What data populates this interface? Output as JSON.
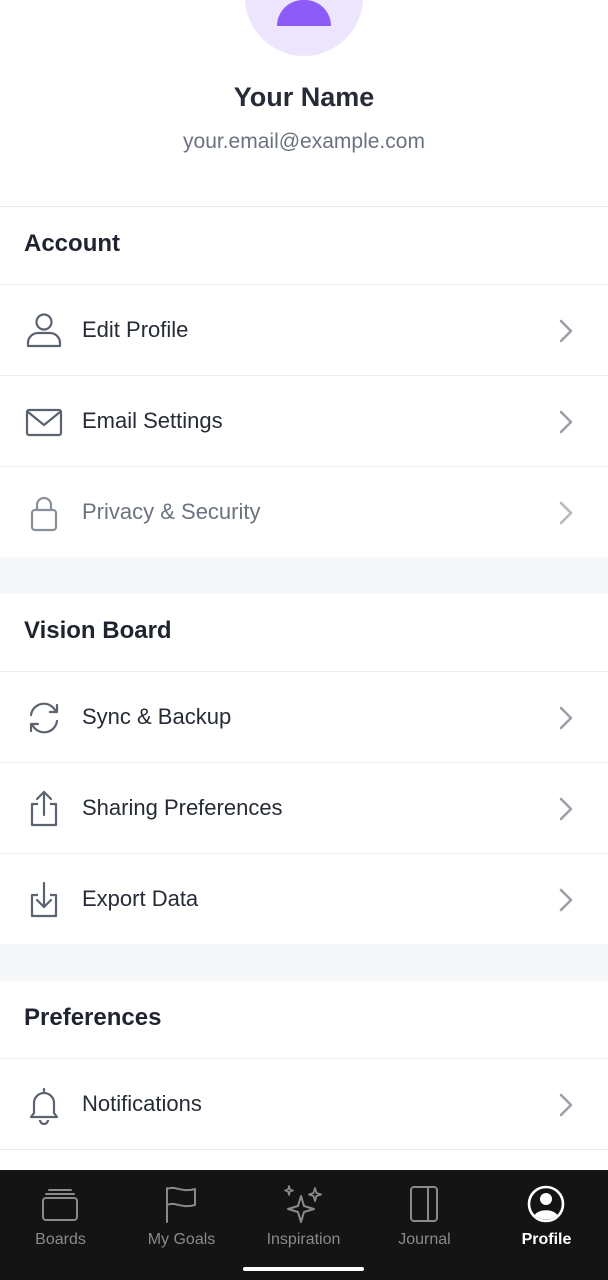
{
  "profile": {
    "name": "Your Name",
    "email": "your.email@example.com",
    "avatar_color": "#8b5cf6",
    "avatar_bg": "#ede4fd"
  },
  "sections": {
    "account": {
      "title": "Account",
      "items": [
        {
          "label": "Edit Profile",
          "icon": "user-icon"
        },
        {
          "label": "Email Settings",
          "icon": "envelope-icon"
        },
        {
          "label": "Privacy & Security",
          "icon": "lock-icon"
        }
      ]
    },
    "vision_board": {
      "title": "Vision Board",
      "items": [
        {
          "label": "Sync & Backup",
          "icon": "sync-icon"
        },
        {
          "label": "Sharing Preferences",
          "icon": "share-icon"
        },
        {
          "label": "Export Data",
          "icon": "download-icon"
        }
      ]
    },
    "preferences": {
      "title": "Preferences",
      "items": [
        {
          "label": "Notifications",
          "icon": "bell-icon"
        }
      ]
    }
  },
  "tabbar": {
    "tabs": [
      {
        "label": "Boards",
        "icon": "boards-icon",
        "active": false
      },
      {
        "label": "My Goals",
        "icon": "flag-icon",
        "active": false
      },
      {
        "label": "Inspiration",
        "icon": "sparkles-icon",
        "active": false
      },
      {
        "label": "Journal",
        "icon": "journal-icon",
        "active": false
      },
      {
        "label": "Profile",
        "icon": "profile-icon",
        "active": true
      }
    ]
  },
  "colors": {
    "tabbar_bg": "#141414",
    "section_gap": "#f6f7f9",
    "text_primary": "#262b36",
    "text_secondary": "#6b7280"
  }
}
